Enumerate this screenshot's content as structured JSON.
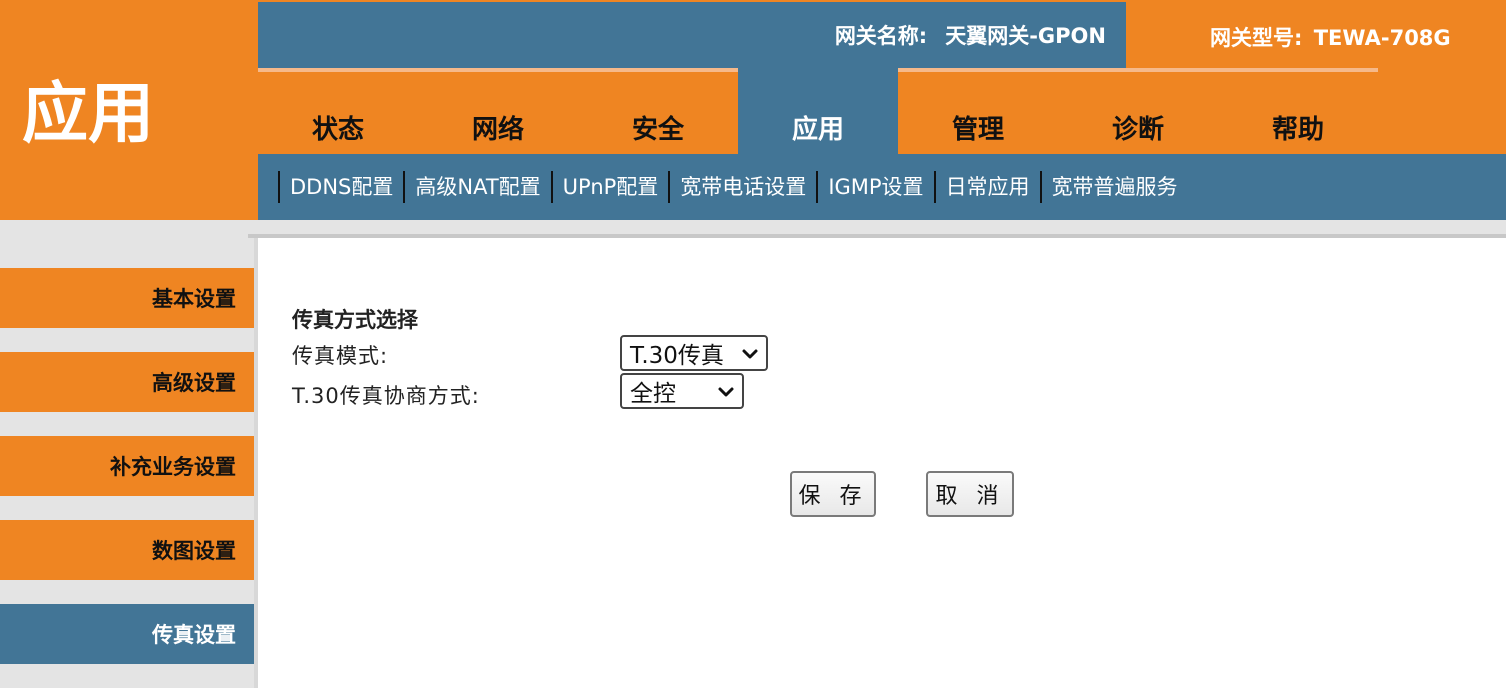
{
  "page_title": "应用",
  "gateway": {
    "name_label": "网关名称:",
    "name_value": "天翼网关-GPON",
    "model_label": "网关型号:",
    "model_value": "TEWA-708G"
  },
  "tabs": [
    {
      "label": "状态"
    },
    {
      "label": "网络"
    },
    {
      "label": "安全"
    },
    {
      "label": "应用",
      "active": true
    },
    {
      "label": "管理"
    },
    {
      "label": "诊断"
    },
    {
      "label": "帮助"
    }
  ],
  "subnav": [
    "DDNS配置",
    "高级NAT配置",
    "UPnP配置",
    "宽带电话设置",
    "IGMP设置",
    "日常应用",
    "宽带普遍服务"
  ],
  "sidebar": [
    {
      "label": "基本设置"
    },
    {
      "label": "高级设置"
    },
    {
      "label": "补充业务设置"
    },
    {
      "label": "数图设置"
    },
    {
      "label": "传真设置",
      "active": true
    }
  ],
  "form": {
    "section_title": "传真方式选择",
    "fax_mode_label": "传真模式:",
    "fax_mode_value": "T.30传真",
    "negotiation_label": "T.30传真协商方式:",
    "negotiation_value": "全控",
    "save_label": "保 存",
    "cancel_label": "取 消"
  },
  "colors": {
    "orange": "#EF8522",
    "blue": "#427596"
  }
}
